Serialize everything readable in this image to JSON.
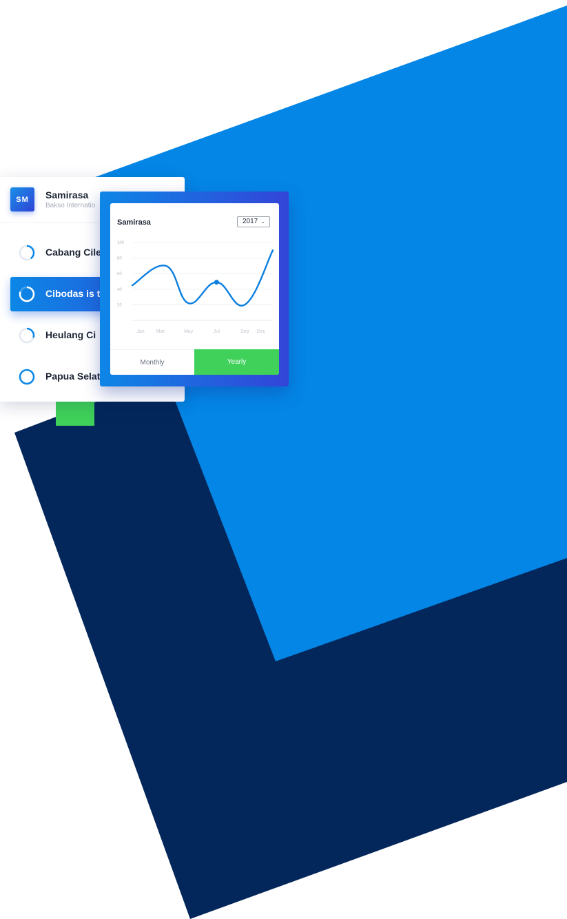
{
  "organization": {
    "initials": "SM",
    "name": "Samirasa",
    "subtitle": "Bakso Internatio"
  },
  "branches": [
    {
      "label": "Cabang Cile",
      "progress": 0.4,
      "active": false
    },
    {
      "label": "Cibodas is t",
      "progress": 0.8,
      "active": true
    },
    {
      "label": "Heulang Ci",
      "progress": 0.3,
      "active": false
    },
    {
      "label": "Papua Selat",
      "progress": 1.0,
      "active": false
    }
  ],
  "chart_panel": {
    "title": "Samirasa",
    "year": "2017",
    "tabs": {
      "monthly": "Monthly",
      "yearly": "Yearly"
    },
    "active_tab": "yearly"
  },
  "chart_data": {
    "type": "line",
    "title": "Samirasa",
    "x_labels": [
      "Jan",
      "Mar",
      "May",
      "Jul",
      "Sep",
      "Dec"
    ],
    "y_ticks": [
      100,
      80,
      60,
      40,
      20
    ],
    "ylim": [
      0,
      100
    ],
    "grid": true,
    "series": [
      {
        "points": [
          [
            0,
            45
          ],
          [
            1.2,
            70
          ],
          [
            2,
            22
          ],
          [
            3,
            49
          ],
          [
            4,
            20
          ],
          [
            5,
            90
          ]
        ],
        "highlight_index": 3
      }
    ]
  },
  "colors": {
    "primary_blue": "#0b87e6",
    "indigo": "#2f43d6",
    "navy": "#04275b",
    "green": "#3fd15a"
  }
}
